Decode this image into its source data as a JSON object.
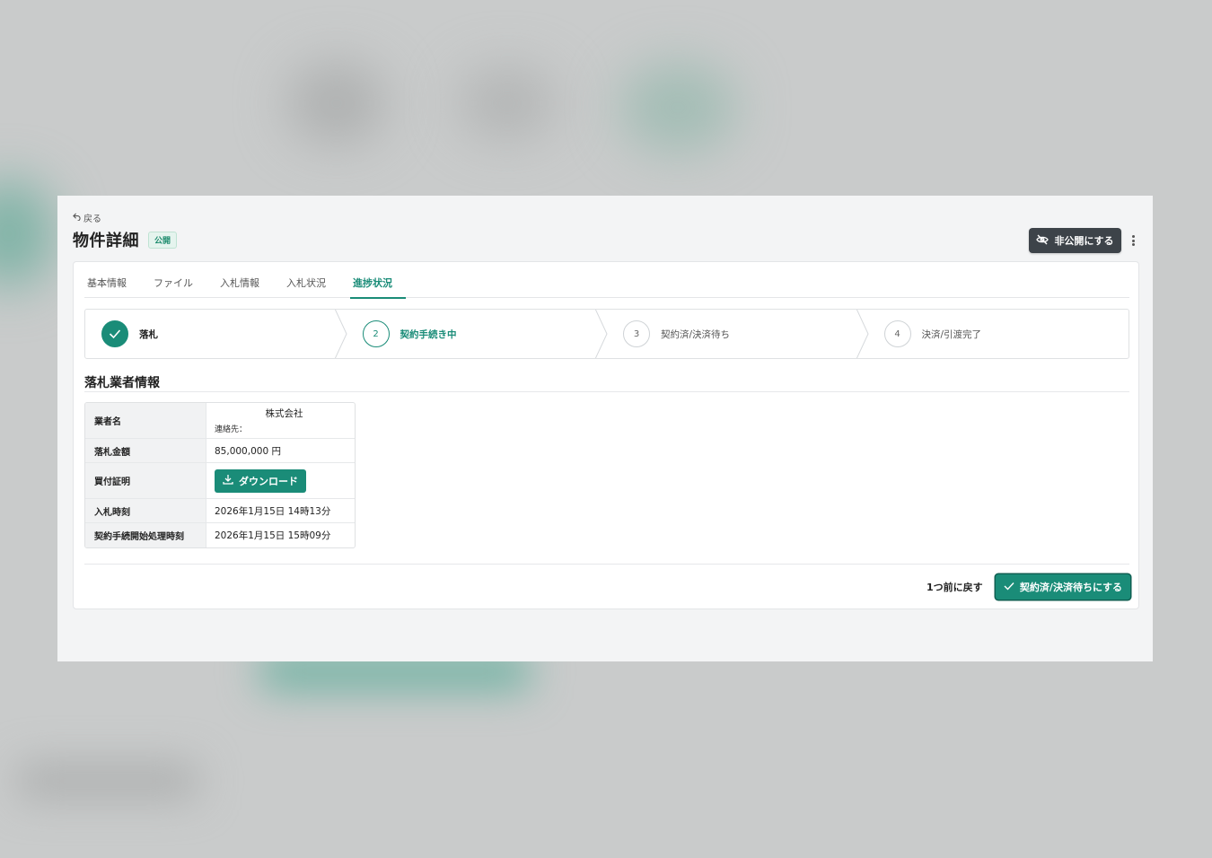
{
  "header": {
    "back_label": "戻る",
    "title": "物件詳細",
    "status_badge": "公開",
    "hide_button_label": "非公開にする"
  },
  "tabs": [
    {
      "label": "基本情報"
    },
    {
      "label": "ファイル"
    },
    {
      "label": "入札情報"
    },
    {
      "label": "入札状況"
    },
    {
      "label": "進捗状況"
    }
  ],
  "active_tab": "進捗状況",
  "stepper": {
    "steps": [
      {
        "number": "",
        "label": "落札",
        "state": "done"
      },
      {
        "number": "2",
        "label": "契約手続き中",
        "state": "current"
      },
      {
        "number": "3",
        "label": "契約済/決済待ち",
        "state": "pending"
      },
      {
        "number": "4",
        "label": "決済/引渡完了",
        "state": "pending"
      }
    ]
  },
  "winner_section": {
    "title": "落札業者情報",
    "rows": {
      "company_label": "業者名",
      "company_name": "株式会社",
      "company_contact": "連絡先：",
      "amount_label": "落札金額",
      "amount_value": "85,000,000 円",
      "certificate_label": "買付証明",
      "download_label": "ダウンロード",
      "bid_time_label": "入札時刻",
      "bid_time_value": "2026年1月15日 14時13分",
      "contract_time_label": "契約手続開始処理時刻",
      "contract_time_value": "2026年1月15日 15時09分"
    }
  },
  "actions": {
    "revert_label": "1つ前に戻す",
    "advance_label": "契約済/決済待ちにする"
  },
  "colors": {
    "accent": "#1a8c78",
    "dark_button": "#3d4349",
    "badge_bg": "#e5f4ee"
  }
}
